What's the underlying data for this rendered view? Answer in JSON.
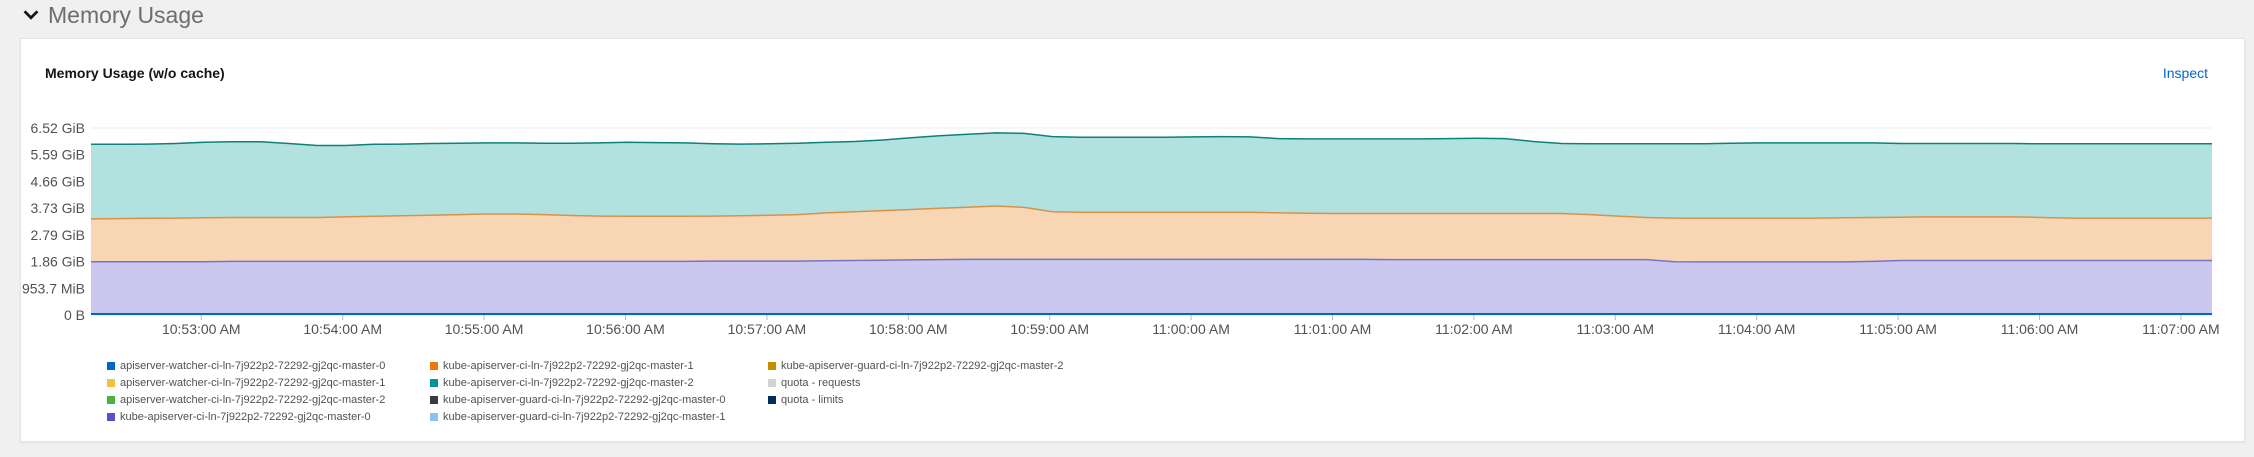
{
  "section": {
    "title": "Memory Usage"
  },
  "card": {
    "title": "Memory Usage (w/o cache)",
    "inspect_label": "Inspect"
  },
  "colors": {
    "accent": "#0066cc",
    "series_stroke_top": "#0d8079",
    "series_fill_top": "#b2e2e0",
    "series_stroke_mid": "#d7924a",
    "series_fill_mid": "#f8d6b4",
    "series_stroke_base": "#7b72c6",
    "series_fill_base": "#cbc8f0",
    "grid": "#ececec"
  },
  "chart_data": {
    "type": "area",
    "stacked": true,
    "title": "Memory Usage (w/o cache)",
    "y_tick_labels": [
      "0 B",
      "953.7 MiB",
      "1.86 GiB",
      "2.79 GiB",
      "3.73 GiB",
      "4.66 GiB",
      "5.59 GiB",
      "6.52 GiB"
    ],
    "y_tick_values_gib": [
      0,
      0.931,
      1.86,
      2.79,
      3.73,
      4.66,
      5.59,
      6.52
    ],
    "ylim_gib": [
      0,
      6.52
    ],
    "x_tick_labels": [
      "10:53:00 AM",
      "10:54:00 AM",
      "10:55:00 AM",
      "10:56:00 AM",
      "10:57:00 AM",
      "10:58:00 AM",
      "10:59:00 AM",
      "11:00:00 AM",
      "11:01:00 AM",
      "11:02:00 AM",
      "11:03:00 AM",
      "11:04:00 AM",
      "11:05:00 AM",
      "11:06:00 AM",
      "11:07:00 AM"
    ],
    "x_minutes": [
      0.0,
      0.2,
      0.4,
      0.6,
      0.8,
      1.0,
      1.2,
      1.4,
      1.6,
      1.8,
      2.0,
      2.2,
      2.4,
      2.6,
      2.8,
      3.0,
      3.2,
      3.4,
      3.6,
      3.8,
      4.0,
      4.2,
      4.4,
      4.6,
      4.8,
      5.0,
      5.2,
      5.4,
      5.6,
      5.8,
      6.0,
      6.2,
      6.4,
      6.6,
      6.8,
      7.0,
      7.2,
      7.4,
      7.6,
      7.8,
      8.0,
      8.2,
      8.4,
      8.6,
      8.8,
      9.0,
      9.2,
      9.4,
      9.6,
      9.8,
      10.0,
      10.2,
      10.4,
      10.6,
      10.8,
      11.0,
      11.2,
      11.4,
      11.6,
      11.8,
      12.0,
      12.2,
      12.4,
      12.6,
      12.8,
      13.0,
      13.2,
      13.4,
      13.6,
      13.8,
      14.0,
      14.2,
      14.4,
      14.6,
      14.8,
      15.0
    ],
    "x_start_label": "10:52:13 AM",
    "series_stack_totals_gib": {
      "base": [
        1.86,
        1.86,
        1.86,
        1.86,
        1.86,
        1.87,
        1.87,
        1.87,
        1.87,
        1.87,
        1.87,
        1.87,
        1.87,
        1.87,
        1.87,
        1.87,
        1.87,
        1.87,
        1.87,
        1.87,
        1.87,
        1.87,
        1.88,
        1.88,
        1.88,
        1.88,
        1.89,
        1.9,
        1.91,
        1.92,
        1.93,
        1.94,
        1.94,
        1.94,
        1.94,
        1.94,
        1.94,
        1.94,
        1.94,
        1.94,
        1.94,
        1.94,
        1.94,
        1.94,
        1.94,
        1.94,
        1.93,
        1.93,
        1.93,
        1.93,
        1.93,
        1.93,
        1.93,
        1.93,
        1.93,
        1.93,
        1.86,
        1.85,
        1.85,
        1.85,
        1.85,
        1.85,
        1.85,
        1.87,
        1.9,
        1.9,
        1.9,
        1.9,
        1.9,
        1.9,
        1.9,
        1.9,
        1.9,
        1.9,
        1.9,
        1.9
      ],
      "mid": [
        3.35,
        3.36,
        3.37,
        3.38,
        3.39,
        3.4,
        3.4,
        3.4,
        3.4,
        3.42,
        3.44,
        3.46,
        3.48,
        3.5,
        3.52,
        3.52,
        3.5,
        3.47,
        3.45,
        3.44,
        3.44,
        3.44,
        3.45,
        3.46,
        3.48,
        3.5,
        3.56,
        3.6,
        3.64,
        3.68,
        3.72,
        3.76,
        3.8,
        3.75,
        3.6,
        3.58,
        3.58,
        3.58,
        3.58,
        3.58,
        3.58,
        3.58,
        3.56,
        3.55,
        3.54,
        3.54,
        3.54,
        3.54,
        3.54,
        3.54,
        3.54,
        3.54,
        3.54,
        3.5,
        3.45,
        3.4,
        3.38,
        3.38,
        3.38,
        3.38,
        3.38,
        3.38,
        3.39,
        3.4,
        3.41,
        3.42,
        3.42,
        3.42,
        3.42,
        3.4,
        3.38,
        3.38,
        3.38,
        3.38,
        3.38,
        3.38
      ],
      "top": [
        5.95,
        5.95,
        5.96,
        5.98,
        6.02,
        6.04,
        6.04,
        5.98,
        5.91,
        5.91,
        5.95,
        5.96,
        5.98,
        5.99,
        6.0,
        6.0,
        5.99,
        5.99,
        6.0,
        6.02,
        6.01,
        6.0,
        5.97,
        5.96,
        5.97,
        5.99,
        6.02,
        6.05,
        6.1,
        6.18,
        6.25,
        6.3,
        6.35,
        6.33,
        6.22,
        6.2,
        6.2,
        6.2,
        6.2,
        6.21,
        6.22,
        6.21,
        6.15,
        6.14,
        6.14,
        6.14,
        6.14,
        6.14,
        6.15,
        6.16,
        6.15,
        6.05,
        5.98,
        5.97,
        5.97,
        5.97,
        5.97,
        5.97,
        5.99,
        6.0,
        6.0,
        6.0,
        6.0,
        6.0,
        5.98,
        5.98,
        5.98,
        5.98,
        5.98,
        5.97,
        5.97,
        5.97,
        5.97,
        5.97,
        5.97,
        5.97
      ]
    },
    "grid": true,
    "legend_position": "bottom",
    "legend": [
      {
        "name": "apiserver-watcher-ci-ln-7j922p2-72292-gj2qc-master-0",
        "color": "#0066cc"
      },
      {
        "name": "apiserver-watcher-ci-ln-7j922p2-72292-gj2qc-master-1",
        "color": "#f4c145"
      },
      {
        "name": "apiserver-watcher-ci-ln-7j922p2-72292-gj2qc-master-2",
        "color": "#4cb140"
      },
      {
        "name": "kube-apiserver-ci-ln-7j922p2-72292-gj2qc-master-0",
        "color": "#5752d1"
      },
      {
        "name": "kube-apiserver-ci-ln-7j922p2-72292-gj2qc-master-1",
        "color": "#ec7a08"
      },
      {
        "name": "kube-apiserver-ci-ln-7j922p2-72292-gj2qc-master-2",
        "color": "#009596"
      },
      {
        "name": "kube-apiserver-guard-ci-ln-7j922p2-72292-gj2qc-master-0",
        "color": "#3b3d41"
      },
      {
        "name": "kube-apiserver-guard-ci-ln-7j922p2-72292-gj2qc-master-1",
        "color": "#8bc1f7"
      },
      {
        "name": "kube-apiserver-guard-ci-ln-7j922p2-72292-gj2qc-master-2",
        "color": "#c58c00"
      },
      {
        "name": "quota - requests",
        "color": "#d2d2d2"
      },
      {
        "name": "quota - limits",
        "color": "#002f5d"
      }
    ]
  }
}
